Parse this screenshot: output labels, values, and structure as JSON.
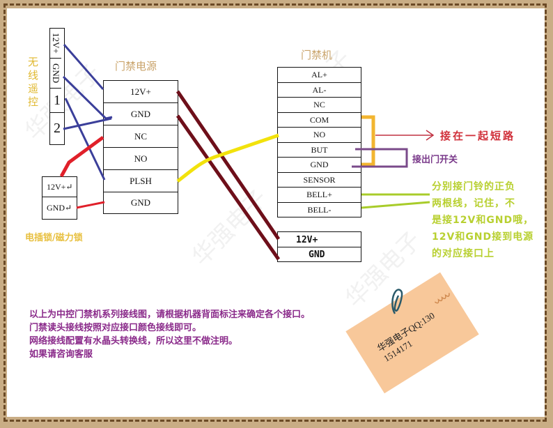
{
  "watermark": "华强电子",
  "remote": {
    "title": "无线遥控",
    "terminals": [
      "12V+",
      "GND",
      "1",
      "2"
    ]
  },
  "power_supply": {
    "title": "门禁电源",
    "terminals": [
      "12V+",
      "GND",
      "NC",
      "NO",
      "PLSH",
      "GND"
    ]
  },
  "lock": {
    "title": "电插锁/磁力锁",
    "terminals": [
      "12V+↵",
      "GND↵"
    ]
  },
  "controller": {
    "title": "门禁机",
    "terminals": [
      "AL+",
      "AL-",
      "NC",
      "COM",
      "NO",
      "BUT",
      "GND",
      "SENSOR",
      "BELL+",
      "BELL-"
    ],
    "power_terminals": [
      "12V+",
      "GND"
    ]
  },
  "annotations": {
    "short_circuit": "接在一起短路",
    "exit_button": "接出门开关",
    "bell_note": [
      "分别接门铃的正负",
      "两根线，记住，不",
      "是接12V和GND哦，",
      "12V和GND接到电源",
      "的对应接口上"
    ]
  },
  "footer_notes": [
    "以上为中控门禁机系列接线图，请根据机器背面标注来确定各个接口。",
    "门禁读头接线按照对应接口颜色接线即可。",
    "网络接线配置有水晶头转换线，所以这里不做注明。",
    "如果请咨询客服"
  ],
  "sticky_note": {
    "line1": "华强电子QQ:130",
    "line2": "1514171"
  },
  "colors": {
    "blue_wire": "#3b3f9a",
    "red_wire": "#e0202a",
    "maroon_wire": "#6e0f1a",
    "yellow_wire": "#f2e20c",
    "orange_bracket": "#f2b530",
    "purple_bracket": "#7a4a8a",
    "green_wire": "#a8cc2a",
    "note_purple": "#8a2a8a",
    "short_red": "#d0303a"
  }
}
